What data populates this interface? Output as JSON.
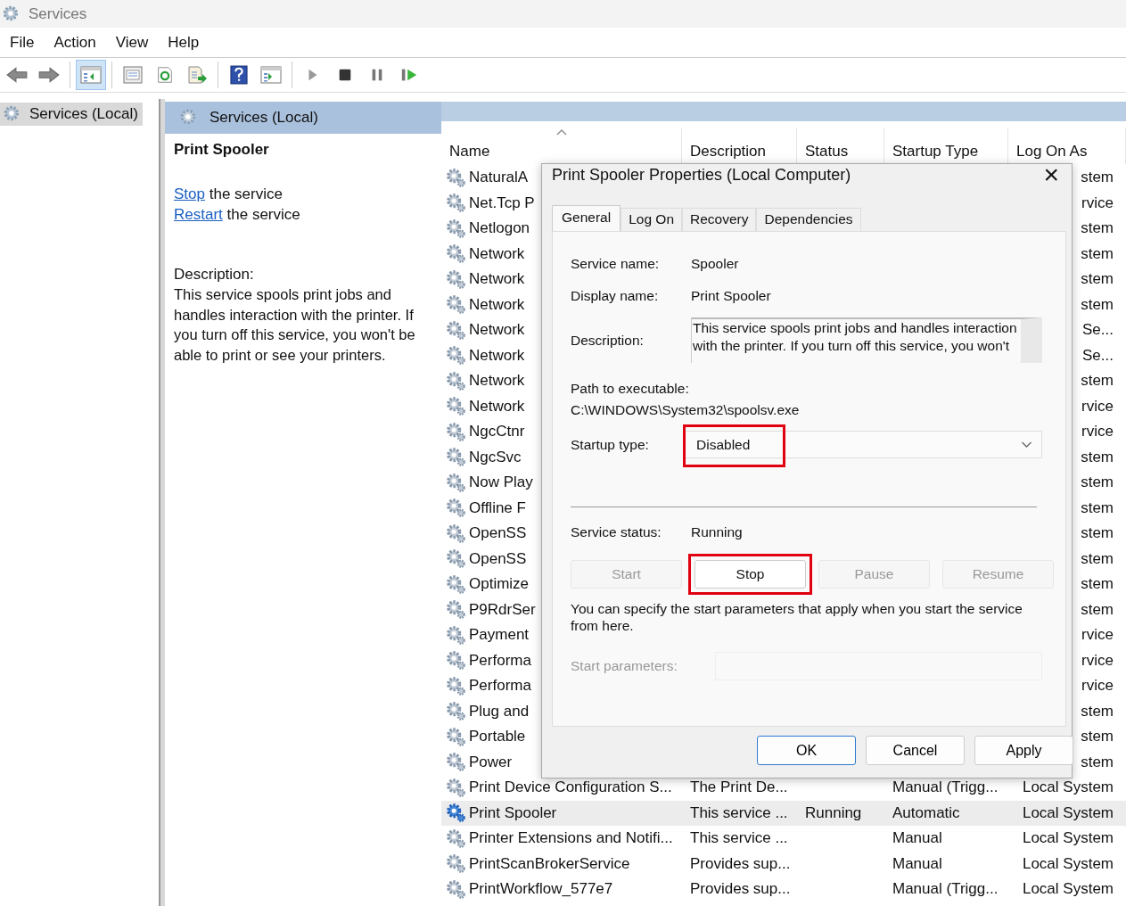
{
  "window": {
    "title": "Services"
  },
  "menu": [
    "File",
    "Action",
    "View",
    "Help"
  ],
  "toolbar": [
    {
      "kind": "back",
      "selected": false
    },
    {
      "kind": "forward",
      "selected": false
    },
    {
      "kind": "separator"
    },
    {
      "kind": "console-tree",
      "selected": true
    },
    {
      "kind": "separator"
    },
    {
      "kind": "properties",
      "selected": false
    },
    {
      "kind": "refresh",
      "selected": false
    },
    {
      "kind": "export",
      "selected": false
    },
    {
      "kind": "separator"
    },
    {
      "kind": "help",
      "selected": false
    },
    {
      "kind": "action-pane",
      "selected": false
    },
    {
      "kind": "separator"
    },
    {
      "kind": "start",
      "selected": false
    },
    {
      "kind": "stop",
      "selected": false
    },
    {
      "kind": "pause",
      "selected": false
    },
    {
      "kind": "resume",
      "selected": false
    }
  ],
  "tree": [
    {
      "label": "Services (Local)",
      "selected": true
    }
  ],
  "pane_header": "Services (Local)",
  "details": {
    "title": "Print Spooler",
    "actions": [
      {
        "link": "Stop",
        "text": "the service"
      },
      {
        "link": "Restart",
        "text": "the service"
      }
    ],
    "description_label": "Description:",
    "description": "This service spools print jobs and handles interaction with the printer. If you turn off this service, you won't be able to print or see your printers."
  },
  "table": {
    "columns": [
      {
        "label": "Name",
        "sorted": true
      },
      {
        "label": "Description",
        "sorted": false
      },
      {
        "label": "Status",
        "sorted": false
      },
      {
        "label": "Startup Type",
        "sorted": false
      },
      {
        "label": "Log On As",
        "sorted": false
      }
    ],
    "rows": [
      {
        "name": "NaturalA",
        "log_on_as": "stem",
        "selected": false
      },
      {
        "name": "Net.Tcp P",
        "log_on_as": "rvice",
        "selected": false
      },
      {
        "name": "Netlogon",
        "log_on_as": "stem",
        "selected": false
      },
      {
        "name": "Network",
        "log_on_as": "stem",
        "selected": false
      },
      {
        "name": "Network",
        "log_on_as": "stem",
        "selected": false
      },
      {
        "name": "Network",
        "log_on_as": "stem",
        "selected": false
      },
      {
        "name": "Network",
        "log_on_as": "Se...",
        "selected": false
      },
      {
        "name": "Network",
        "log_on_as": "Se...",
        "selected": false
      },
      {
        "name": "Network",
        "log_on_as": "stem",
        "selected": false
      },
      {
        "name": "Network",
        "log_on_as": "rvice",
        "selected": false
      },
      {
        "name": "NgcCtnr",
        "log_on_as": "rvice",
        "selected": false
      },
      {
        "name": "NgcSvc",
        "log_on_as": "stem",
        "selected": false
      },
      {
        "name": "Now Play",
        "log_on_as": "stem",
        "selected": false
      },
      {
        "name": "Offline F",
        "log_on_as": "stem",
        "selected": false
      },
      {
        "name": "OpenSS",
        "log_on_as": "stem",
        "selected": false
      },
      {
        "name": "OpenSS",
        "log_on_as": "stem",
        "selected": false
      },
      {
        "name": "Optimize",
        "log_on_as": "stem",
        "selected": false
      },
      {
        "name": "P9RdrSer",
        "log_on_as": "stem",
        "selected": false
      },
      {
        "name": "Payment",
        "log_on_as": "rvice",
        "selected": false
      },
      {
        "name": "Performa",
        "log_on_as": "rvice",
        "selected": false
      },
      {
        "name": "Performa",
        "log_on_as": "rvice",
        "selected": false
      },
      {
        "name": "Plug and",
        "log_on_as": "stem",
        "selected": false
      },
      {
        "name": "Portable",
        "log_on_as": "stem",
        "selected": false
      },
      {
        "name": "Power",
        "log_on_as": "stem",
        "selected": false
      },
      {
        "name": "Print Device Configuration S...",
        "description": "The Print De...",
        "startup_type": "Manual (Trigg...",
        "log_on_as": "Local System",
        "selected": false
      },
      {
        "name": "Print Spooler",
        "description": "This service ...",
        "status": "Running",
        "startup_type": "Automatic",
        "log_on_as": "Local System",
        "selected": true
      },
      {
        "name": "Printer Extensions and Notifi...",
        "description": "This service ...",
        "startup_type": "Manual",
        "log_on_as": "Local System",
        "selected": false
      },
      {
        "name": "PrintScanBrokerService",
        "description": "Provides sup...",
        "startup_type": "Manual",
        "log_on_as": "Local System",
        "selected": false
      },
      {
        "name": "PrintWorkflow_577e7",
        "description": "Provides sup...",
        "startup_type": "Manual (Trigg...",
        "log_on_as": "Local System",
        "selected": false
      }
    ]
  },
  "dialog": {
    "title": "Print Spooler Properties (Local Computer)",
    "close": "×",
    "tabs": [
      {
        "label": "General",
        "selected": true
      },
      {
        "label": "Log On",
        "selected": false
      },
      {
        "label": "Recovery",
        "selected": false
      },
      {
        "label": "Dependencies",
        "selected": false
      }
    ],
    "fields": [
      {
        "label": "Service name:",
        "value": "Spooler"
      },
      {
        "label": "Display name:",
        "value": "Print Spooler"
      }
    ],
    "description": {
      "label": "Description:",
      "value": "This service spools print jobs and handles interaction with the printer.  If you turn off this service, you won't"
    },
    "path": {
      "label": "Path to executable:",
      "value": "C:\\WINDOWS\\System32\\spoolsv.exe"
    },
    "startup_type": {
      "label": "Startup type:",
      "value": "Disabled",
      "highlighted": true
    },
    "status": {
      "label": "Service status:",
      "value": "Running"
    },
    "service_buttons": [
      {
        "label": "Start",
        "disabled": true,
        "highlighted": false
      },
      {
        "label": "Stop",
        "disabled": false,
        "highlighted": true
      },
      {
        "label": "Pause",
        "disabled": true,
        "highlighted": false
      },
      {
        "label": "Resume",
        "disabled": true,
        "highlighted": false
      }
    ],
    "hint": "You can specify the start parameters that apply when you start the service from here.",
    "start_parameters": {
      "label": "Start parameters:",
      "disabled": true
    },
    "buttons": [
      {
        "label": "OK",
        "default": true
      },
      {
        "label": "Cancel",
        "default": false
      },
      {
        "label": "Apply",
        "default": false
      }
    ]
  }
}
